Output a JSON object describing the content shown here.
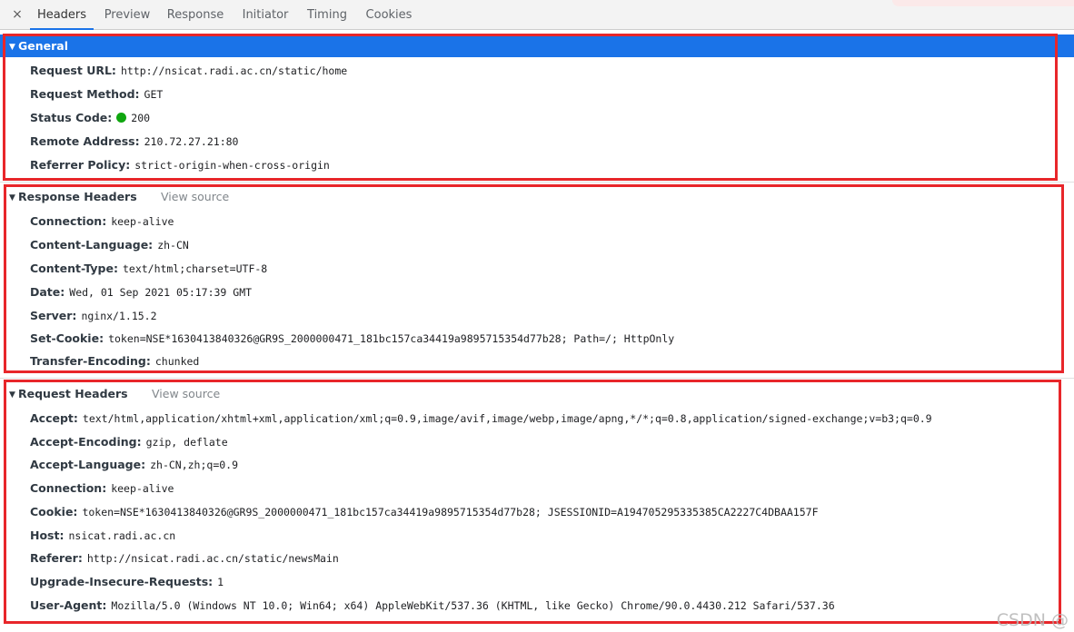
{
  "tabs": {
    "close_glyph": "×",
    "items": [
      "Headers",
      "Preview",
      "Response",
      "Initiator",
      "Timing",
      "Cookies"
    ],
    "active": "Headers"
  },
  "general": {
    "title": "General",
    "rows": [
      {
        "key": "Request URL:",
        "value": "http://nsicat.radi.ac.cn/static/home"
      },
      {
        "key": "Request Method:",
        "value": "GET"
      },
      {
        "key": "Status Code:",
        "value": "200",
        "status_color": "#0fa60f"
      },
      {
        "key": "Remote Address:",
        "value": "210.72.27.21:80"
      },
      {
        "key": "Referrer Policy:",
        "value": "strict-origin-when-cross-origin"
      }
    ]
  },
  "response_headers": {
    "title": "Response Headers",
    "view_source": "View source",
    "rows": [
      {
        "key": "Connection:",
        "value": "keep-alive"
      },
      {
        "key": "Content-Language:",
        "value": "zh-CN"
      },
      {
        "key": "Content-Type:",
        "value": "text/html;charset=UTF-8"
      },
      {
        "key": "Date:",
        "value": "Wed, 01 Sep 2021 05:17:39 GMT"
      },
      {
        "key": "Server:",
        "value": "nginx/1.15.2"
      },
      {
        "key": "Set-Cookie:",
        "value": "token=NSE*1630413840326@GR9S_2000000471_181bc157ca34419a9895715354d77b28; Path=/; HttpOnly"
      },
      {
        "key": "Transfer-Encoding:",
        "value": "chunked"
      }
    ]
  },
  "request_headers": {
    "title": "Request Headers",
    "view_source": "View source",
    "rows": [
      {
        "key": "Accept:",
        "value": "text/html,application/xhtml+xml,application/xml;q=0.9,image/avif,image/webp,image/apng,*/*;q=0.8,application/signed-exchange;v=b3;q=0.9"
      },
      {
        "key": "Accept-Encoding:",
        "value": "gzip, deflate"
      },
      {
        "key": "Accept-Language:",
        "value": "zh-CN,zh;q=0.9"
      },
      {
        "key": "Connection:",
        "value": "keep-alive"
      },
      {
        "key": "Cookie:",
        "value": "token=NSE*1630413840326@GR9S_2000000471_181bc157ca34419a9895715354d77b28; JSESSIONID=A194705295335385CA2227C4DBAA157F"
      },
      {
        "key": "Host:",
        "value": "nsicat.radi.ac.cn"
      },
      {
        "key": "Referer:",
        "value": "http://nsicat.radi.ac.cn/static/newsMain"
      },
      {
        "key": "Upgrade-Insecure-Requests:",
        "value": "1"
      },
      {
        "key": "User-Agent:",
        "value": "Mozilla/5.0 (Windows NT 10.0; Win64; x64) AppleWebKit/537.36 (KHTML, like Gecko) Chrome/90.0.4430.212 Safari/537.36"
      }
    ]
  },
  "watermark": "CSDN @",
  "colors": {
    "accent": "#1a73e8",
    "highlight_box": "#e8262a",
    "status_ok": "#0fa60f"
  }
}
